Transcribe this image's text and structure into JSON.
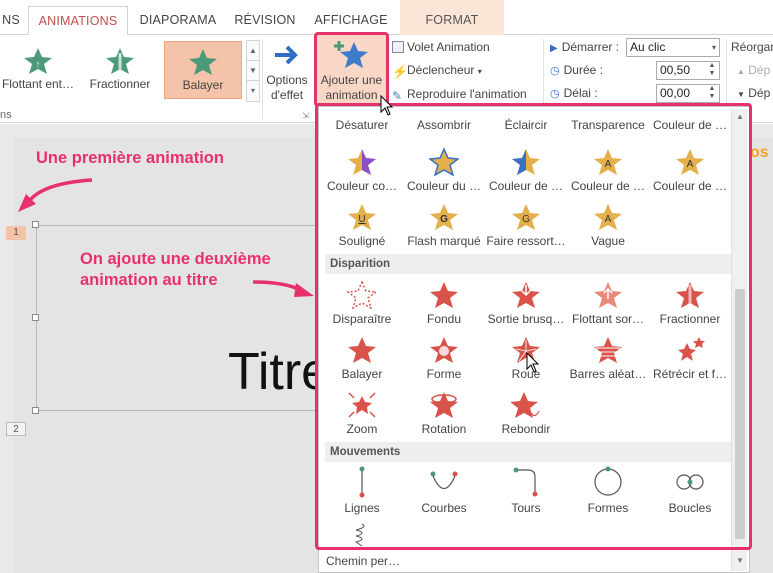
{
  "tabs": {
    "partial": "NS",
    "animations": "ANIMATIONS",
    "diaporama": "DIAPORAMA",
    "revision": "RÉVISION",
    "affichage": "AFFICHAGE",
    "format": "FORMAT"
  },
  "ribbon": {
    "gallery": [
      {
        "label": "Flottant ent…",
        "selected": false
      },
      {
        "label": "Fractionner",
        "selected": false
      },
      {
        "label": "Balayer",
        "selected": true
      }
    ],
    "options_effet": "Options\nd'effet",
    "options_l1": "Options",
    "options_l2": "d'effet",
    "ajouter_l1": "Ajouter une",
    "ajouter_l2": "animation",
    "volet": "Volet Animation",
    "declencheur": "Déclencheur",
    "reproduire": "Reproduire l'animation",
    "demarrer_label": "Démarrer :",
    "demarrer_value": "Au clic",
    "duree_label": "Durée :",
    "duree_value": "00,50",
    "delai_label": "Délai :",
    "delai_value": "00,00",
    "reorganiser": "Réorgar",
    "dep1": "Dép",
    "dep2": "Dép",
    "group_partial": "ns"
  },
  "slide": {
    "title_text": "Titre",
    "tag1": "1",
    "tag2": "2",
    "callout1": "Une première animation",
    "callout2_l1": "On ajoute une deuxième",
    "callout2_l2": "animation au titre",
    "peek": "os"
  },
  "dropdown": {
    "row_top": [
      "Désaturer",
      "Assombrir",
      "Éclaircir",
      "Transparence",
      "Couleur de …"
    ],
    "row_a": [
      "Couleur co…",
      "Couleur du …",
      "Couleur de …",
      "Couleur de …",
      "Couleur de …"
    ],
    "row_b": [
      "Souligné",
      "Flash marqué",
      "Faire ressort…",
      "Vague"
    ],
    "section_disparition": "Disparition",
    "disp_row1": [
      "Disparaître",
      "Fondu",
      "Sortie brusq…",
      "Flottant sor…",
      "Fractionner"
    ],
    "disp_row2": [
      "Balayer",
      "Forme",
      "Roue",
      "Barres aléat…",
      "Rétrécir et f…"
    ],
    "disp_row3": [
      "Zoom",
      "Rotation",
      "Rebondir"
    ],
    "section_mouvements": "Mouvements",
    "mouv": [
      "Lignes",
      "Courbes",
      "Tours",
      "Formes",
      "Boucles"
    ],
    "more": "Chemin per…"
  },
  "colors": {
    "accent_pink": "#e8316b",
    "exit_red": "#d9534a",
    "entrance_green": "#4c9a7a",
    "tab_active": "#c0504d",
    "selected_bg": "#f5c3a9"
  }
}
